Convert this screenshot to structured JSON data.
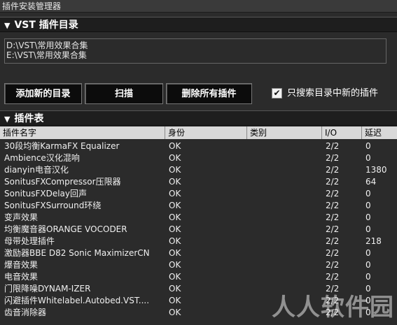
{
  "window": {
    "title": "插件安装管理器"
  },
  "vst_section": {
    "title": "VST 插件目录",
    "toggle": "▼"
  },
  "directories": [
    "D:\\VST\\常用效果合集",
    "E:\\VST\\常用效果合集"
  ],
  "buttons": {
    "add_dir": "添加新的目录",
    "scan": "扫描",
    "delete_all": "删除所有插件"
  },
  "option": {
    "only_new_label": "只搜索目录中新的插件",
    "checked": true,
    "check_mark": "✔"
  },
  "table_section": {
    "title": "插件表",
    "toggle": "▼"
  },
  "columns": {
    "name": "插件名字",
    "status": "身份",
    "category": "类别",
    "io": "I/O",
    "latency": "延迟"
  },
  "rows": [
    {
      "name": "30段均衡KarmaFX Equalizer",
      "status": "OK",
      "category": "",
      "io": "2/2",
      "latency": "0"
    },
    {
      "name": "Ambience汉化混响",
      "status": "OK",
      "category": "",
      "io": "2/2",
      "latency": "0"
    },
    {
      "name": "dianyin电音汉化",
      "status": "OK",
      "category": "",
      "io": "2/2",
      "latency": "1380"
    },
    {
      "name": "SonitusFXCompressor压限器",
      "status": "OK",
      "category": "",
      "io": "2/2",
      "latency": "64"
    },
    {
      "name": "SonitusFXDelay回声",
      "status": "OK",
      "category": "",
      "io": "2/2",
      "latency": "0"
    },
    {
      "name": "SonitusFXSurround环绕",
      "status": "OK",
      "category": "",
      "io": "2/2",
      "latency": "0"
    },
    {
      "name": "变声效果",
      "status": "OK",
      "category": "",
      "io": "2/2",
      "latency": "0"
    },
    {
      "name": "均衡魔音器ORANGE VOCODER",
      "status": "OK",
      "category": "",
      "io": "2/2",
      "latency": "0"
    },
    {
      "name": "母带处理插件",
      "status": "OK",
      "category": "",
      "io": "2/2",
      "latency": "218"
    },
    {
      "name": "激励器BBE D82 Sonic MaximizerCN",
      "status": "OK",
      "category": "",
      "io": "2/2",
      "latency": "0"
    },
    {
      "name": "爆音效果",
      "status": "OK",
      "category": "",
      "io": "2/2",
      "latency": "0"
    },
    {
      "name": "电音效果",
      "status": "OK",
      "category": "",
      "io": "2/2",
      "latency": "0"
    },
    {
      "name": "门限降噪DYNAM-IZER",
      "status": "OK",
      "category": "",
      "io": "2/2",
      "latency": "0"
    },
    {
      "name": "闪避插件Whitelabel.Autobed.VST....",
      "status": "OK",
      "category": "",
      "io": "2/2",
      "latency": "0"
    },
    {
      "name": "齿音消除器",
      "status": "OK",
      "category": "",
      "io": "2/2",
      "latency": "0"
    }
  ],
  "watermark": "人人软件园"
}
